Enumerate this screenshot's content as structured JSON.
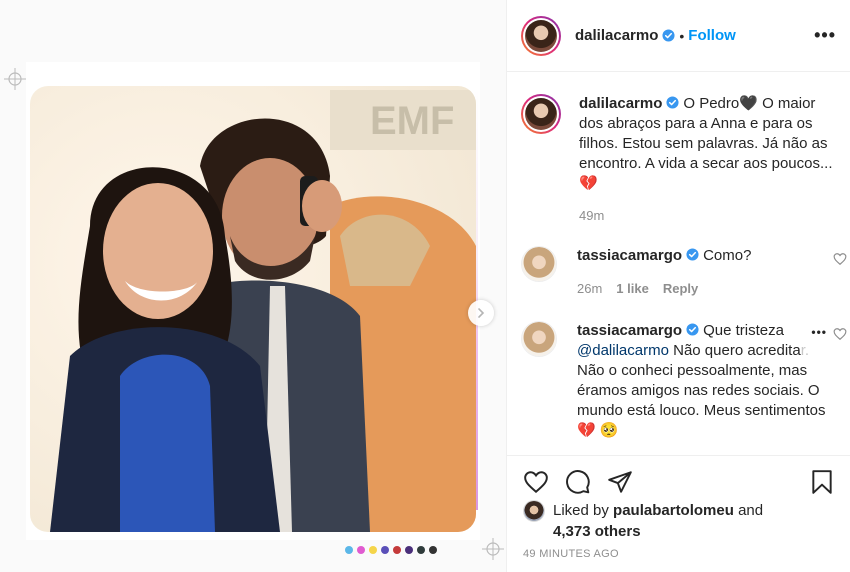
{
  "post": {
    "author": "dalilacarmo",
    "follow_label": "Follow",
    "separator": "•",
    "carousel_dot_colors": [
      "#5bb7e8",
      "#e05bd0",
      "#f5d54a",
      "#5a4fb8",
      "#c43a3a",
      "#4a2f7a",
      "#2f3b3b",
      "#333333"
    ]
  },
  "caption": {
    "author": "dalilacarmo",
    "text": "O Pedro🖤 O maior dos abraços para a Anna e para os filhos. Estou sem palavras. Já não as encontro. A vida a secar aos poucos... 💔",
    "time": "49m"
  },
  "comments": [
    {
      "author": "tassiacamargo",
      "text": "Como?",
      "time": "26m",
      "likes": "1 like",
      "reply": "Reply"
    },
    {
      "author": "tassiacamargo",
      "text_start": "Que tristeza",
      "mention": "@dalilacarmo",
      "text_mid": "Não quero acredita",
      "text_faded": "r.",
      "text_end": "Não o conheci pessoalmente, mas éramos amigos nas redes sociais. O mundo está louco. Meus sentimentos 💔 🥺",
      "more": "•••"
    }
  ],
  "likes": {
    "prefix": "Liked by",
    "user": "paulabartolomeu",
    "joiner": "and",
    "others": "4,373 others"
  },
  "timestamp": "49 MINUTES AGO",
  "icons": [
    "verified-badge-icon",
    "more-options-icon",
    "chevron-right-icon",
    "heart-icon",
    "comment-icon",
    "share-icon",
    "bookmark-icon"
  ]
}
